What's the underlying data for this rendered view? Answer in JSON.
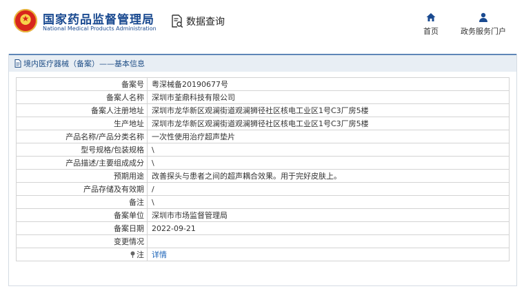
{
  "header": {
    "brand_cn": "国家药品监督管理局",
    "brand_en": "National Medical Products Administration",
    "query_label": "数据查询",
    "nav": [
      {
        "label": "首页",
        "icon": "home-icon"
      },
      {
        "label": "政务服务门户",
        "icon": "user-icon"
      }
    ]
  },
  "panel": {
    "title": "境内医疗器械（备案）——基本信息"
  },
  "rows": [
    {
      "key": "备案号",
      "value": "粤深械备20190677号"
    },
    {
      "key": "备案人名称",
      "value": "深圳市荃鼎科技有限公司"
    },
    {
      "key": "备案人注册地址",
      "value": "深圳市龙华新区观澜街道观澜狮径社区核电工业区1号C3厂房5楼"
    },
    {
      "key": "生产地址",
      "value": "深圳市龙华新区观澜街道观澜狮径社区核电工业区1号C3厂房5楼"
    },
    {
      "key": "产品名称/产品分类名称",
      "value": "一次性使用治疗超声垫片"
    },
    {
      "key": "型号规格/包装规格",
      "value": "\\"
    },
    {
      "key": "产品描述/主要组成成分",
      "value": "\\"
    },
    {
      "key": "预期用途",
      "value": "改善探头与患者之间的超声耦合效果。用于完好皮肤上。"
    },
    {
      "key": "产品存储及有效期",
      "value": "/"
    },
    {
      "key": "备注",
      "value": "\\"
    },
    {
      "key": "备案单位",
      "value": "深圳市市场监督管理局"
    },
    {
      "key": "备案日期",
      "value": "2022-09-21"
    },
    {
      "key": "变更情况",
      "value": ""
    }
  ],
  "note_row": {
    "key": "注",
    "value": "详情"
  }
}
